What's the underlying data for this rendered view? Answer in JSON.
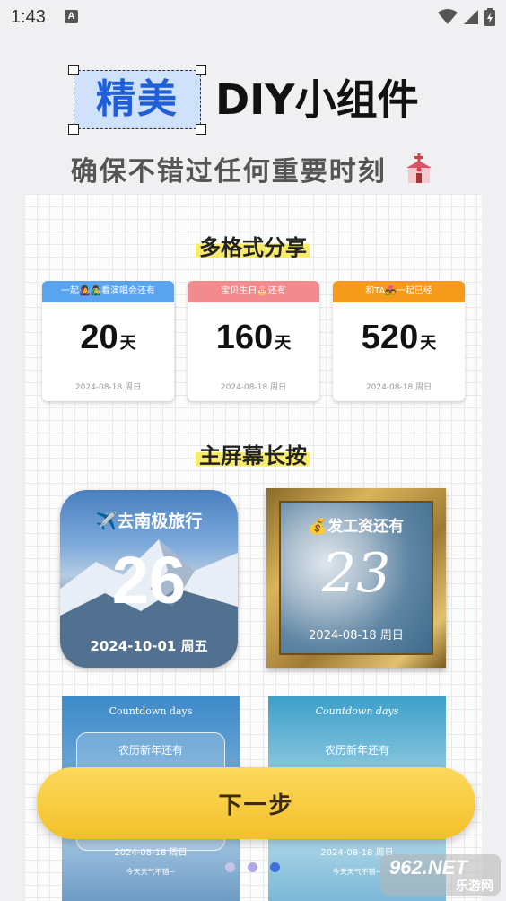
{
  "status_bar": {
    "time": "1:43",
    "notification_letter": "A"
  },
  "hero": {
    "title_highlight": "精美",
    "title_rest": "DIY小组件",
    "subtitle": "确保不错过任何重要时刻"
  },
  "sections": {
    "share": "多格式分享",
    "home": "主屏幕长按"
  },
  "share_cards": [
    {
      "header": "一起👩‍🎤👨‍🎤看演唱会还有",
      "number": "20",
      "unit": "天",
      "date": "2024-08-18 周日",
      "color": "#5aa3ef"
    },
    {
      "header": "宝贝生日🎂还有",
      "number": "160",
      "unit": "天",
      "date": "2024-08-18 周日",
      "color": "#f28b8e"
    },
    {
      "header": "和TA💑一起已经",
      "number": "520",
      "unit": "天",
      "date": "2024-08-18 周日",
      "color": "#f59a1b"
    }
  ],
  "widgets": {
    "mountain": {
      "title": "✈️去南极旅行",
      "number": "26",
      "date": "2024-10-01 周五"
    },
    "frame": {
      "title": "💰发工资还有",
      "number": "23",
      "date": "2024-08-18 周日"
    }
  },
  "posters": [
    {
      "top": "Countdown days",
      "subtitle": "农历新年还有",
      "date": "2024-08-18 周日",
      "footer": "今天天气不错~"
    },
    {
      "top": "Countdown days",
      "subtitle": "农历新年还有",
      "date": "2024-08-18 周日",
      "footer": "今天天气不错~"
    }
  ],
  "pager": {
    "dot_colors": [
      "#c9c3e8",
      "#b4a9e6",
      "#3f6fe0"
    ],
    "active_index": 2
  },
  "next_button": "下一步",
  "watermark": {
    "main": "962.NET",
    "sub": "乐游网"
  }
}
